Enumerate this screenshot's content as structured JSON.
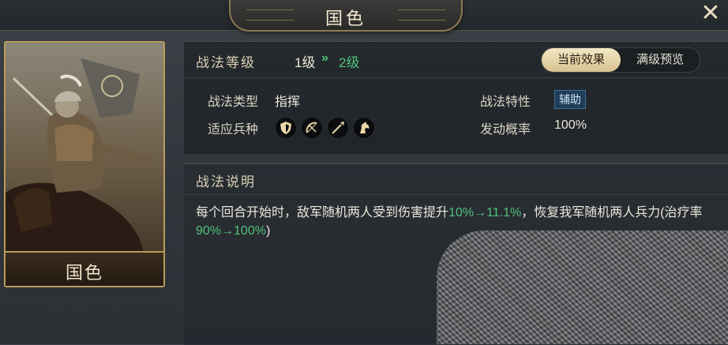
{
  "window": {
    "title": "国色",
    "close_icon": "close-icon"
  },
  "card": {
    "name": "国色",
    "portrait": "mounted-general-portrait"
  },
  "level": {
    "label": "战法等级",
    "current": "1级",
    "arrow": "»",
    "next": "2级"
  },
  "toggle": {
    "current_effect": "当前效果",
    "max_preview": "满级预览",
    "active": "当前效果"
  },
  "attributes": {
    "type_label": "战法类型",
    "type_value": "指挥",
    "trait_label": "战法特性",
    "trait_value": "辅助",
    "troops_label": "适应兵种",
    "troops_icons": [
      "shield-icon",
      "bow-icon",
      "spear-icon",
      "horse-icon"
    ],
    "trigger_label": "发动概率",
    "trigger_value": "100%"
  },
  "description": {
    "title": "战法说明",
    "part1": "每个回合开始时，敌军随机两人受到伤害提升",
    "part2": "10%→11.1%",
    "part3": "，恢复我军随机两人兵力(治疗率",
    "part4": "90%→100%",
    "part5": ")"
  },
  "colors": {
    "upgrade_green": "#4fc27a",
    "gold_border": "#b89a5b",
    "tag_blue": "#1f3e5a"
  }
}
